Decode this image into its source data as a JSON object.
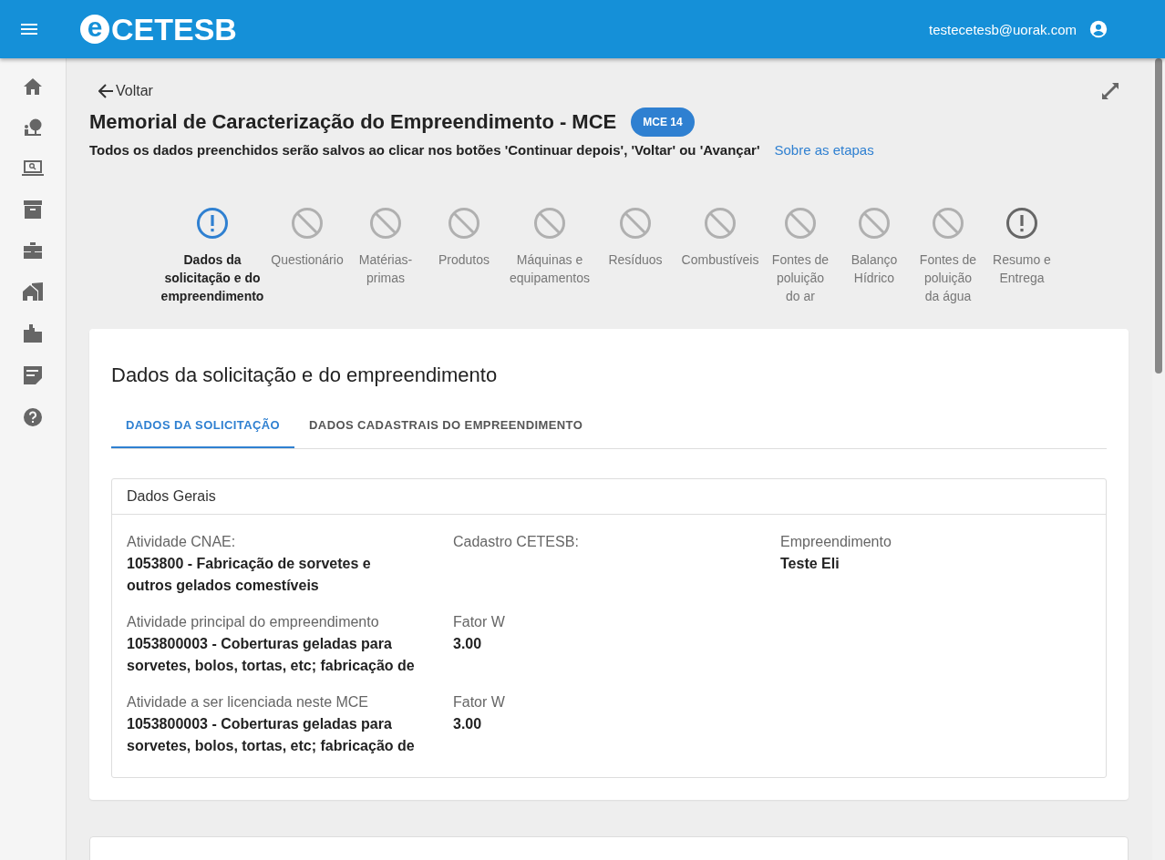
{
  "header": {
    "logo_letter": "e",
    "logo_text": "CETESB",
    "user_email": "testecetesb@uorak.com"
  },
  "back_link": "Voltar",
  "title": "Memorial de Caracterização do Empreendimento - MCE",
  "badge": "MCE 14",
  "subtitle": "Todos os dados preenchidos serão salvos ao clicar nos botões 'Continuar depois', 'Voltar' ou 'Avançar'",
  "help_link": "Sobre as etapas",
  "steps": [
    {
      "label": "Dados da solicitação e do empreendimento",
      "kind": "current",
      "selected": true
    },
    {
      "label": "Questionário",
      "kind": "blocked",
      "selected": false
    },
    {
      "label": "Matérias-primas",
      "kind": "blocked",
      "selected": false
    },
    {
      "label": "Produtos",
      "kind": "blocked",
      "selected": false
    },
    {
      "label": "Máquinas e equipamentos",
      "kind": "blocked",
      "selected": false
    },
    {
      "label": "Resíduos",
      "kind": "blocked",
      "selected": false
    },
    {
      "label": "Combustíveis",
      "kind": "blocked",
      "selected": false
    },
    {
      "label": "Fontes de poluição do ar",
      "kind": "blocked",
      "selected": false
    },
    {
      "label": "Balanço Hídrico",
      "kind": "blocked",
      "selected": false
    },
    {
      "label": "Fontes de poluição da água",
      "kind": "blocked",
      "selected": false
    },
    {
      "label": "Resumo e Entrega",
      "kind": "pending",
      "selected": false
    }
  ],
  "section_title": "Dados da solicitação e do empreendimento",
  "tabs": [
    {
      "label": "DADOS DA SOLICITAÇÃO",
      "selected": true
    },
    {
      "label": "DADOS CADASTRAIS DO EMPREENDIMENTO",
      "selected": false
    }
  ],
  "panel": {
    "title": "Dados Gerais",
    "rows": [
      [
        {
          "label": "Atividade CNAE:",
          "value": "1053800 - Fabricação de sorvetes e outros gelados comestíveis"
        },
        {
          "label": "Cadastro CETESB:"
        },
        {
          "label": "Empreendimento",
          "value": "Teste Eli"
        }
      ],
      [
        {
          "label": "Atividade principal do empreendimento",
          "value": "1053800003 - Coberturas geladas para sorvetes, bolos, tortas, etc; fabricação de"
        },
        {
          "label": "Fator W",
          "value": "3.00"
        }
      ],
      [
        {
          "label": "Atividade a ser licenciada neste MCE",
          "value": "1053800003 - Coberturas geladas para sorvetes, bolos, tortas, etc; fabricação de"
        },
        {
          "label": "Fator W",
          "value": "3.00"
        }
      ]
    ]
  }
}
